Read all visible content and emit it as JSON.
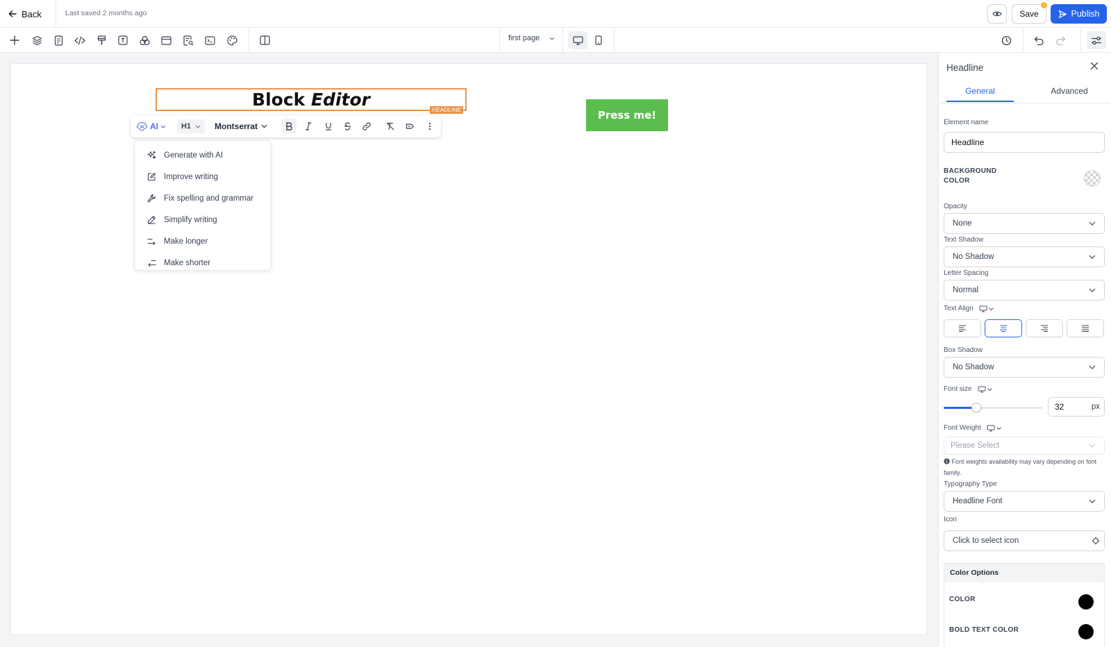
{
  "topbar": {
    "back_label": "Back",
    "last_saved": "Last saved 2 months ago",
    "save_label": "Save",
    "publish_label": "Publish",
    "notification_color": "#f5b83d"
  },
  "toolbar": {
    "tools": [
      "plus-icon",
      "layers-icon",
      "page-icon",
      "code-icon",
      "brush-icon",
      "text-icon",
      "shapes-icon",
      "browser-icon",
      "search-doc-icon",
      "terminal-icon",
      "palette-icon",
      "split-view-icon"
    ],
    "page_select": "first page",
    "device": "desktop"
  },
  "canvas": {
    "headline_word1": "Block",
    "headline_word2": "Editor",
    "headline_tag": "HEADLINE",
    "button_label": "Press me!",
    "button_color": "#5cbd4f",
    "selection_color": "#e8944a"
  },
  "format_bar": {
    "ai_label": "AI",
    "heading_level": "H1",
    "font_family": "Montserrat"
  },
  "ai_menu": [
    {
      "icon": "sparkles-icon",
      "label": "Generate with AI"
    },
    {
      "icon": "edit-icon",
      "label": "Improve writing"
    },
    {
      "icon": "wrench-icon",
      "label": "Fix spelling and grammar"
    },
    {
      "icon": "pen-icon",
      "label": "Simplify writing"
    },
    {
      "icon": "arrow-longer-icon",
      "label": "Make longer"
    },
    {
      "icon": "arrow-shorter-icon",
      "label": "Make shorter"
    }
  ],
  "panel": {
    "title": "Headline",
    "tab_general": "General",
    "tab_advanced": "Advanced",
    "element_name_label": "Element name",
    "element_name_value": "Headline",
    "background_color_label_1": "BACKGROUND",
    "background_color_label_2": "COLOR",
    "opacity_label": "Opacity",
    "opacity_value": "None",
    "text_shadow_label": "Text Shadow",
    "text_shadow_value": "No Shadow",
    "letter_spacing_label": "Letter Spacing",
    "letter_spacing_value": "Normal",
    "text_align_label": "Text Align",
    "text_align_value": "center",
    "box_shadow_label": "Box Shadow",
    "box_shadow_value": "No Shadow",
    "font_size_label": "Font size",
    "font_size_value": "32",
    "font_size_unit": "px",
    "font_size_slider_fraction": 0.33,
    "font_weight_label": "Font Weight",
    "font_weight_placeholder": "Please Select",
    "font_weight_note": "Font weights availability may vary depending on font family.",
    "typography_type_label": "Typography Type",
    "typography_type_value": "Headline Font",
    "icon_label": "Icon",
    "icon_value": "Click to select icon",
    "color_options_header": "Color Options",
    "color_label": "COLOR",
    "color_value": "#000000",
    "bold_text_color_label": "BOLD TEXT COLOR",
    "bold_text_color_value": "#000000",
    "accent_color": "#2563eb"
  }
}
